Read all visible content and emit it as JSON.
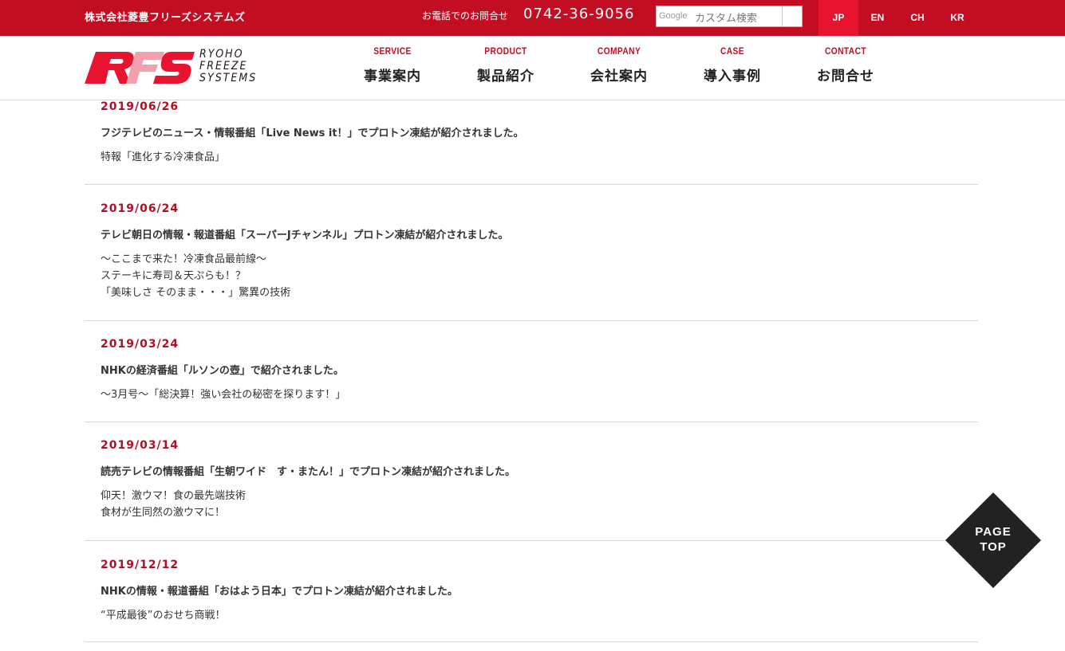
{
  "topbar": {
    "company_name": "株式会社菱豊フリーズシステムズ",
    "phone_label": "お電話でのお問合せ",
    "phone_number": "0742-36-9056",
    "search": {
      "google_mark": "Google",
      "placeholder": "カスタム検索",
      "button_icon": "search-icon"
    },
    "languages": [
      {
        "label": "JP",
        "active": true
      },
      {
        "label": "EN",
        "active": false
      },
      {
        "label": "CH",
        "active": false
      },
      {
        "label": "KR",
        "active": false
      }
    ]
  },
  "header": {
    "logo_mark": "RFS",
    "logo_lines": [
      "RYOHO",
      "FREEZE",
      "SYSTEMS"
    ],
    "nav": [
      {
        "en": "SERVICE",
        "ja": "事業案内"
      },
      {
        "en": "PRODUCT",
        "ja": "製品紹介"
      },
      {
        "en": "COMPANY",
        "ja": "会社案内"
      },
      {
        "en": "CASE",
        "ja": "導入事例"
      },
      {
        "en": "CONTACT",
        "ja": "お問合せ"
      }
    ]
  },
  "news": [
    {
      "date": "2019/06/26",
      "title": "フジテレビのニュース・情報番組「Live News it！」でプロトン凍結が紹介されました。",
      "desc": [
        "特報「進化する冷凍食品」"
      ]
    },
    {
      "date": "2019/06/24",
      "title": "テレビ朝日の情報・報道番組「スーパーJチャンネル」プロトン凍結が紹介されました。",
      "desc": [
        "～ここまで来た！冷凍食品最前線～",
        "ステーキに寿司＆天ぷらも！？",
        "「美味しさ そのまま・・・」驚異の技術"
      ]
    },
    {
      "date": "2019/03/24",
      "title": "NHKの経済番組「ルソンの壺」で紹介されました。",
      "desc": [
        "～3月号～「総決算！強い会社の秘密を探ります！」"
      ]
    },
    {
      "date": "2019/03/14",
      "title": "読売テレビの情報番組「生朝ワイド　す・またん！」でプロトン凍結が紹介されました。",
      "desc": [
        "仰天！激ウマ！食の最先端技術",
        "食材が生同然の激ウマに！"
      ]
    },
    {
      "date": "2019/12/12",
      "title": "NHKの情報・報道番組「おはよう日本」でプロトン凍結が紹介されました。",
      "desc": [
        "“平成最後”のおせち商戦！"
      ]
    }
  ],
  "page_top": {
    "line1": "PAGE",
    "line2": "TOP"
  },
  "colors": {
    "brand_red": "#c30d23",
    "active_lang": "#e8132f",
    "date_red": "#b40e25",
    "page_top_bg": "#222222"
  }
}
